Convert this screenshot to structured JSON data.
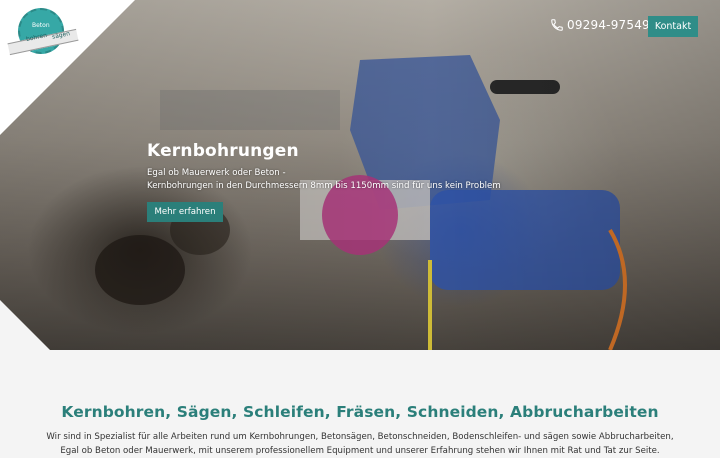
{
  "header": {
    "logo_text": [
      "Beton",
      "bohren",
      "sägen"
    ],
    "phone": "09294-975499",
    "contact_button": "Kontakt"
  },
  "hero": {
    "title": "Kernbohrungen",
    "line1": "Egal ob Mauerwerk oder Beton -",
    "line2": "Kernbohrungen in den Durchmessern 8mm bis 1150mm sind für uns kein Problem",
    "button": "Mehr erfahren"
  },
  "content": {
    "title": "Kernbohren, Sägen, Schleifen, Fräsen, Schneiden, Abbrucharbeiten",
    "text": "Wir sind in Spezialist für alle Arbeiten rund um Kernbohrungen, Betonsägen, Betonschneiden, Bodenschleifen- und sägen sowie Abbrucharbeiten, Egal ob Beton oder Mauerwerk, mit unserem professionellem Equipment und unserer Erfahrung stehen wir Ihnen mit Rat und Tat zur Seite."
  },
  "colors": {
    "accent": "#2f8d88",
    "title_teal": "#2b7f7a"
  },
  "icons": {
    "phone": "phone-icon",
    "logo": "logo-icon"
  }
}
